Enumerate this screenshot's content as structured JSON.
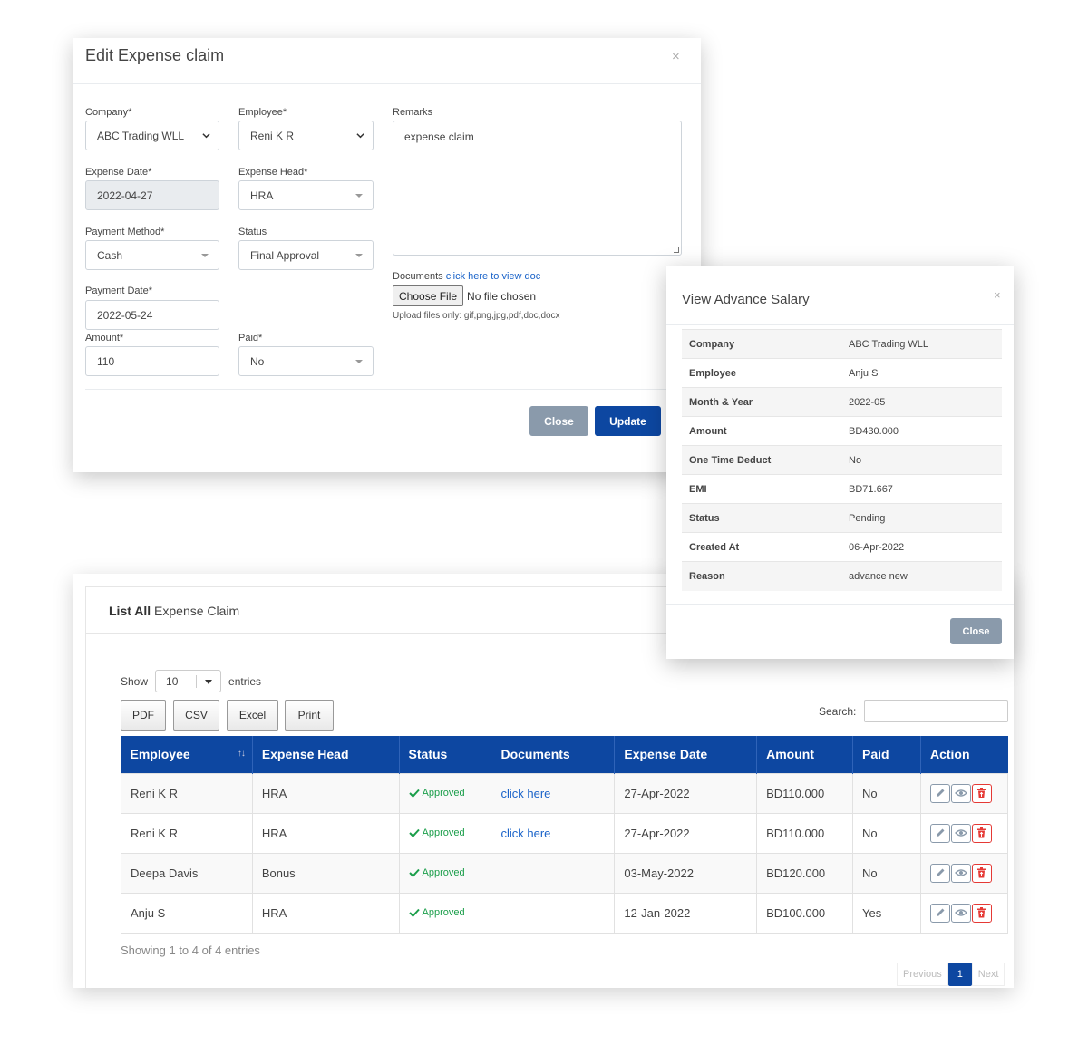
{
  "edit_modal": {
    "title": "Edit Expense claim",
    "close_glyph": "×",
    "company_label": "Company*",
    "company_value": "ABC Trading WLL",
    "employee_label": "Employee*",
    "employee_value": "Reni K R",
    "remarks_label": "Remarks",
    "remarks_value": "expense claim",
    "expense_date_label": "Expense Date*",
    "expense_date_value": "2022-04-27",
    "expense_head_label": "Expense Head*",
    "expense_head_value": "HRA",
    "payment_method_label": "Payment Method*",
    "payment_method_value": "Cash",
    "status_label": "Status",
    "status_value": "Final Approval",
    "payment_date_label": "Payment Date*",
    "payment_date_value": "2022-05-24",
    "amount_label": "Amount*",
    "amount_value": "110",
    "paid_label": "Paid*",
    "paid_value": "No",
    "documents_label": "Documents",
    "documents_link": "click here to view doc",
    "choose_file": "Choose File",
    "no_file": "No file chosen",
    "upload_hint": "Upload files only: gif,png,jpg,pdf,doc,docx",
    "close_btn": "Close",
    "update_btn": "Update"
  },
  "view_modal": {
    "title": "View Advance Salary",
    "close_glyph": "×",
    "rows": [
      {
        "key": "Company",
        "value": "ABC Trading WLL"
      },
      {
        "key": "Employee",
        "value": "Anju S"
      },
      {
        "key": "Month & Year",
        "value": "2022-05"
      },
      {
        "key": "Amount",
        "value": "BD430.000"
      },
      {
        "key": "One Time Deduct",
        "value": "No"
      },
      {
        "key": "EMI",
        "value": "BD71.667"
      },
      {
        "key": "Status",
        "value": "Pending"
      },
      {
        "key": "Created At",
        "value": "06-Apr-2022"
      },
      {
        "key": "Reason",
        "value": "advance new"
      }
    ],
    "close_btn": "Close"
  },
  "list": {
    "title_bold": "List All",
    "title_rest": " Expense Claim",
    "show_label": "Show",
    "entries_label": "entries",
    "page_length": "10",
    "export_buttons": [
      "PDF",
      "CSV",
      "Excel",
      "Print"
    ],
    "search_label": "Search:",
    "columns": [
      "Employee",
      "Expense Head",
      "Status",
      "Documents",
      "Expense Date",
      "Amount",
      "Paid",
      "Action"
    ],
    "rows": [
      {
        "employee": "Reni K R",
        "head": "HRA",
        "status": "Approved",
        "doc": "click here",
        "date": "27-Apr-2022",
        "amount": "BD110.000",
        "paid": "No"
      },
      {
        "employee": "Reni K R",
        "head": "HRA",
        "status": "Approved",
        "doc": "click here",
        "date": "27-Apr-2022",
        "amount": "BD110.000",
        "paid": "No"
      },
      {
        "employee": "Deepa Davis",
        "head": "Bonus",
        "status": "Approved",
        "doc": "",
        "date": "03-May-2022",
        "amount": "BD120.000",
        "paid": "No"
      },
      {
        "employee": "Anju S",
        "head": "HRA",
        "status": "Approved",
        "doc": "",
        "date": "12-Jan-2022",
        "amount": "BD100.000",
        "paid": "Yes"
      }
    ],
    "showing": "Showing 1 to 4 of 4 entries",
    "pager": {
      "prev": "Previous",
      "current": "1",
      "next": "Next"
    }
  },
  "colors": {
    "primary": "#0d47a1",
    "success": "#1a9e4a",
    "link": "#1a63c9",
    "danger": "#e53935",
    "muted_btn": "#8a9aab"
  }
}
